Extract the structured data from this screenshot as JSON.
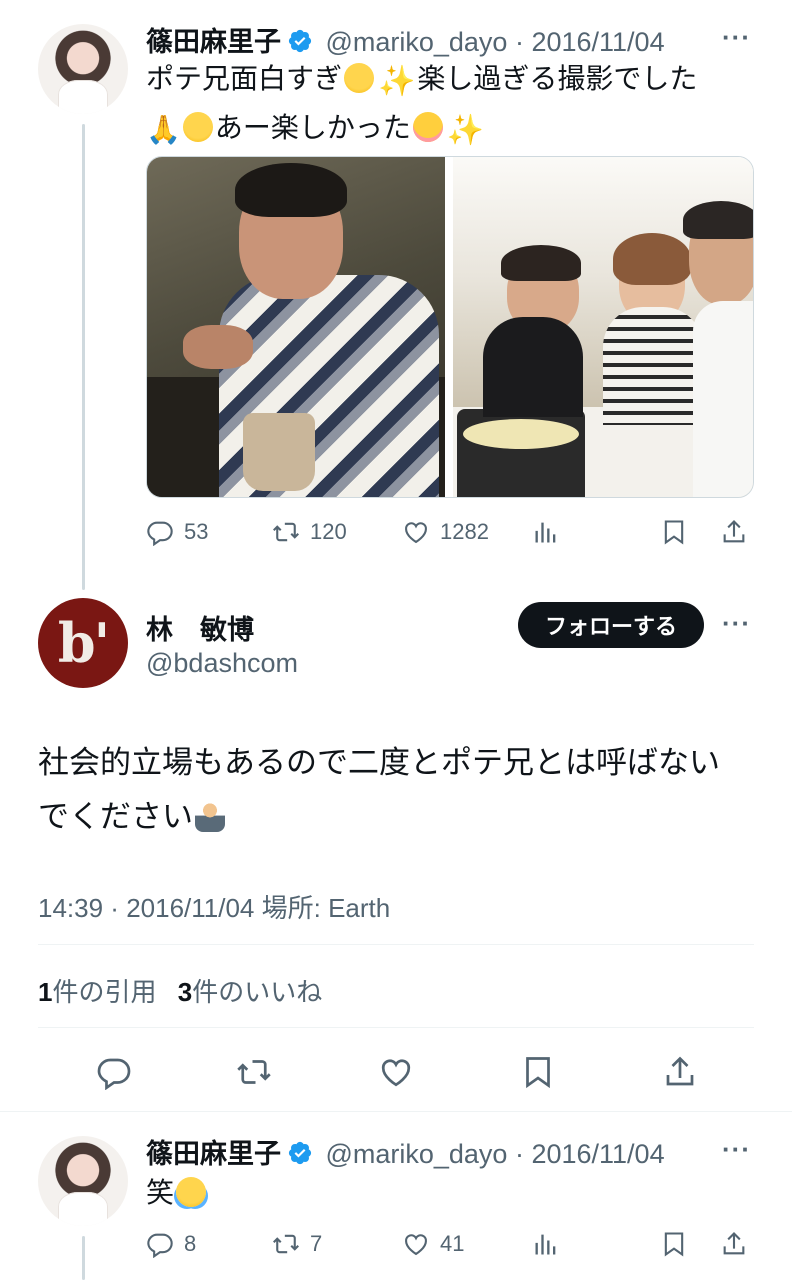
{
  "tweet1": {
    "name": "篠田麻里子",
    "handle": "@mariko_dayo",
    "date": "2016/11/04",
    "text_line1": "ポテ兄面白すぎ",
    "text_line1b": "楽し過ぎる撮影でした",
    "text_line2": "あー楽しかった",
    "stats": {
      "replies": "53",
      "retweets": "120",
      "likes": "1282"
    }
  },
  "main": {
    "name": "林　敏博",
    "handle": "@bdashcom",
    "avatar_letter": "b'",
    "follow_label": "フォローする",
    "text_line1": "社会的立場もあるので二度とポテ兄とは呼ばない",
    "text_line2": "でください",
    "time": "14:39",
    "date": "2016/11/04",
    "location": "場所: Earth",
    "quotes_count": "1",
    "quotes_label": "件の引用",
    "likes_count": "3",
    "likes_label": "件のいいね"
  },
  "tweet3": {
    "name": "篠田麻里子",
    "handle": "@mariko_dayo",
    "date": "2016/11/04",
    "text": "笑",
    "stats": {
      "replies": "8",
      "retweets": "7",
      "likes": "41"
    }
  },
  "icons": [
    "verified-badge-icon",
    "more-icon",
    "reply-icon",
    "retweet-icon",
    "like-icon",
    "views-icon",
    "bookmark-icon",
    "share-icon"
  ],
  "colors": {
    "verified": "#1d9bf0",
    "text": "#0f1419",
    "secondary": "#536471",
    "divider": "#eff3f4",
    "follow_bg": "#0f1419"
  }
}
